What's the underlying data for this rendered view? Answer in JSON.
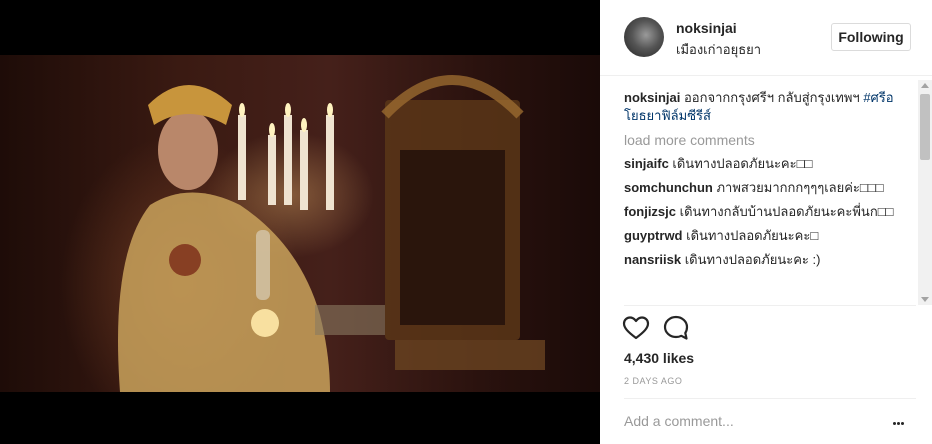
{
  "post": {
    "username": "noksinjai",
    "location": "เมืองเก่าอยุธยา",
    "follow_label": "Following",
    "caption": {
      "username": "noksinjai",
      "text": "ออกจากกรุงศรีฯ กลับสู่กรุงเทพฯ ",
      "hashtag": "#ศรีอโยธยาฟิล์มซีรีส์"
    },
    "load_more": "load more comments",
    "comments": [
      {
        "username": "sinjaifc",
        "text": "เดินทางปลอดภัยนะคะ□□"
      },
      {
        "username": "somchunchun",
        "text": "ภาพสวยมากกกๆๆๆเลยค่ะ□□□"
      },
      {
        "username": "fonjizsjc",
        "text": "เดินทางกลับบ้านปลอดภัยนะคะพี่นก□□"
      },
      {
        "username": "guyptrwd",
        "text": "เดินทางปลอดภัยนะคะ□"
      },
      {
        "username": "nansriisk",
        "text": "เดินทางปลอดภัยนะคะ :)"
      }
    ],
    "likes": "4,430 likes",
    "time": "2 DAYS AGO",
    "add_comment_placeholder": "Add a comment...",
    "icons": {
      "like": "heart-icon",
      "comment": "speech-bubble-icon",
      "more": "more-options-icon"
    }
  }
}
